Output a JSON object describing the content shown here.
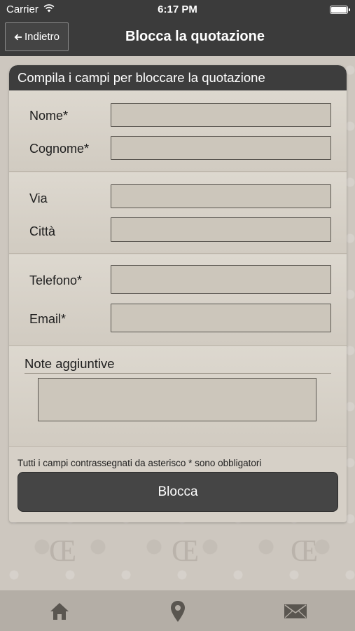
{
  "status_bar": {
    "carrier": "Carrier",
    "time": "6:17 PM",
    "wifi_icon": "wifi-icon",
    "battery_icon": "battery-icon"
  },
  "nav": {
    "back_label": "Indietro",
    "back_icon": "arrow-left-icon",
    "title": "Blocca la quotazione"
  },
  "form": {
    "header": "Compila i campi per bloccare la quotazione",
    "fields": [
      {
        "label": "Nome*",
        "value": ""
      },
      {
        "label": "Cognome*",
        "value": ""
      },
      {
        "label": "Via",
        "value": ""
      },
      {
        "label": "Città",
        "value": ""
      },
      {
        "label": "Telefono*",
        "value": ""
      },
      {
        "label": "Email*",
        "value": ""
      }
    ],
    "notes_label": "Note aggiuntive",
    "notes_value": "",
    "required_note": "Tutti i campi contrassegnati da asterisco * sono obbligatori",
    "submit_label": "Blocca"
  },
  "tab_bar": {
    "items": [
      "home-icon",
      "location-pin-icon",
      "mail-icon"
    ]
  },
  "colors": {
    "bar": "#3b3b3b",
    "card": "#d6d0c7",
    "input": "#ccc6bb",
    "button": "#454545",
    "tab_bar": "#b4aea6",
    "tab_icon": "#5a5650"
  }
}
